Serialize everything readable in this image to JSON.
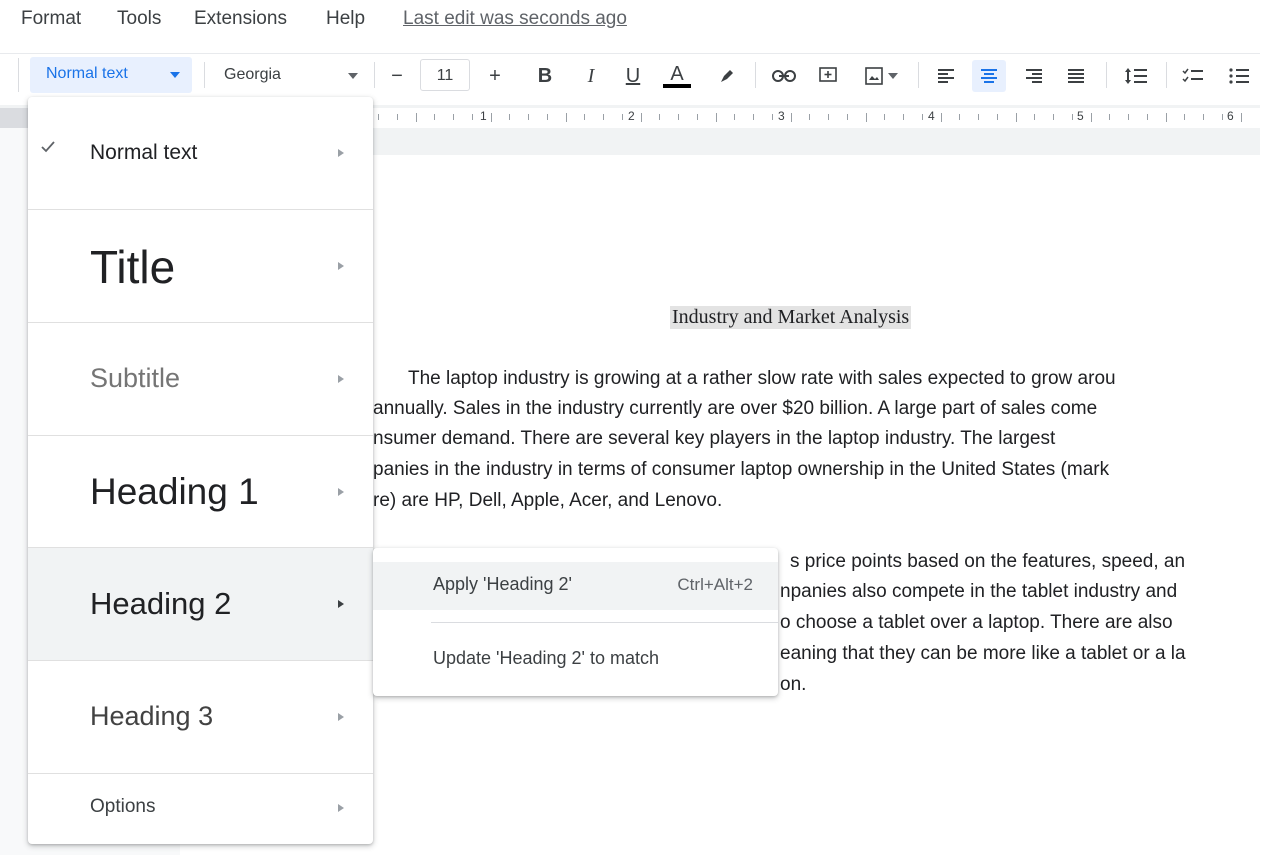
{
  "menubar": {
    "items": [
      "Format",
      "Tools",
      "Extensions",
      "Help"
    ],
    "last_edit": "Last edit was seconds ago"
  },
  "toolbar": {
    "style_value": "Normal text",
    "font_value": "Georgia",
    "font_size": "11",
    "bold": "B",
    "italic": "I",
    "underline": "U",
    "text_color": "A",
    "decrease": "−",
    "increase": "+",
    "accent_color": "#1a73e8"
  },
  "ruler": {
    "numbers": [
      "1",
      "2",
      "3",
      "4",
      "5",
      "6"
    ]
  },
  "style_menu": {
    "items": [
      {
        "label": "Normal text",
        "checked": true
      },
      {
        "label": "Title"
      },
      {
        "label": "Subtitle"
      },
      {
        "label": "Heading 1"
      },
      {
        "label": "Heading 2"
      },
      {
        "label": "Heading 3"
      },
      {
        "label": "Options"
      }
    ]
  },
  "submenu": {
    "apply_label": "Apply 'Heading 2'",
    "apply_shortcut": "Ctrl+Alt+2",
    "update_label": "Update 'Heading 2' to match"
  },
  "document": {
    "title": "Industry and Market Analysis",
    "lines": [
      "The laptop industry is growing at a rather slow rate with sales expected to grow arou",
      "annually.  Sales in the industry currently are over $20 billion.  A large part of sales come",
      "nsumer demand. There are several key players in the laptop industry.  The largest",
      "panies in the industry in terms of consumer laptop ownership in the United States (mark",
      "re) are HP, Dell, Apple, Acer, and Lenovo.",
      "s price points based on the features, speed, an",
      "npanies also compete in the tablet industry and",
      "o choose a tablet over a laptop.  There are also",
      "eaning that they can be more like a tablet or a la",
      "on."
    ]
  }
}
